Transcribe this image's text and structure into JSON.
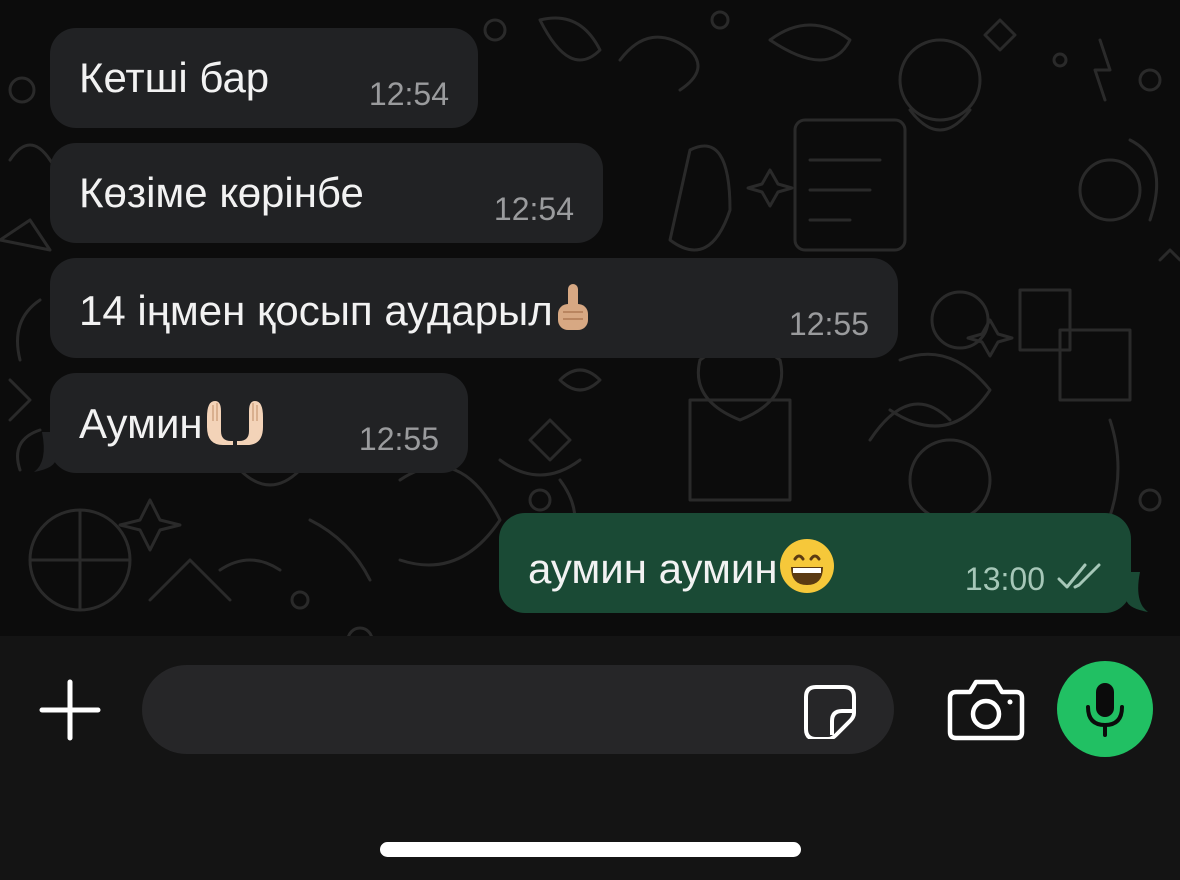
{
  "messages": [
    {
      "direction": "incoming",
      "text": "Кетші бар",
      "time": "12:54"
    },
    {
      "direction": "incoming",
      "text": "Көзіме көрінбе",
      "time": "12:54"
    },
    {
      "direction": "incoming",
      "text": "14 іңмен қосып аударыл",
      "emoji": "☝🏼",
      "time": "12:55"
    },
    {
      "direction": "incoming",
      "text": "Аумин",
      "emoji": "🤲🏻",
      "time": "12:55"
    },
    {
      "direction": "outgoing",
      "text": "аумин аумин",
      "emoji": "😄",
      "time": "13:00",
      "status": "double-check-read"
    }
  ],
  "composer": {
    "placeholder": "",
    "value": "",
    "icons": {
      "attach": "plus-icon",
      "sticker": "sticker-icon",
      "camera": "camera-icon",
      "voice": "microphone-icon"
    }
  },
  "colors": {
    "incoming_bubble": "#212224",
    "outgoing_bubble": "#1a4a35",
    "mic_button": "#21c063",
    "background": "#0c0c0c"
  }
}
